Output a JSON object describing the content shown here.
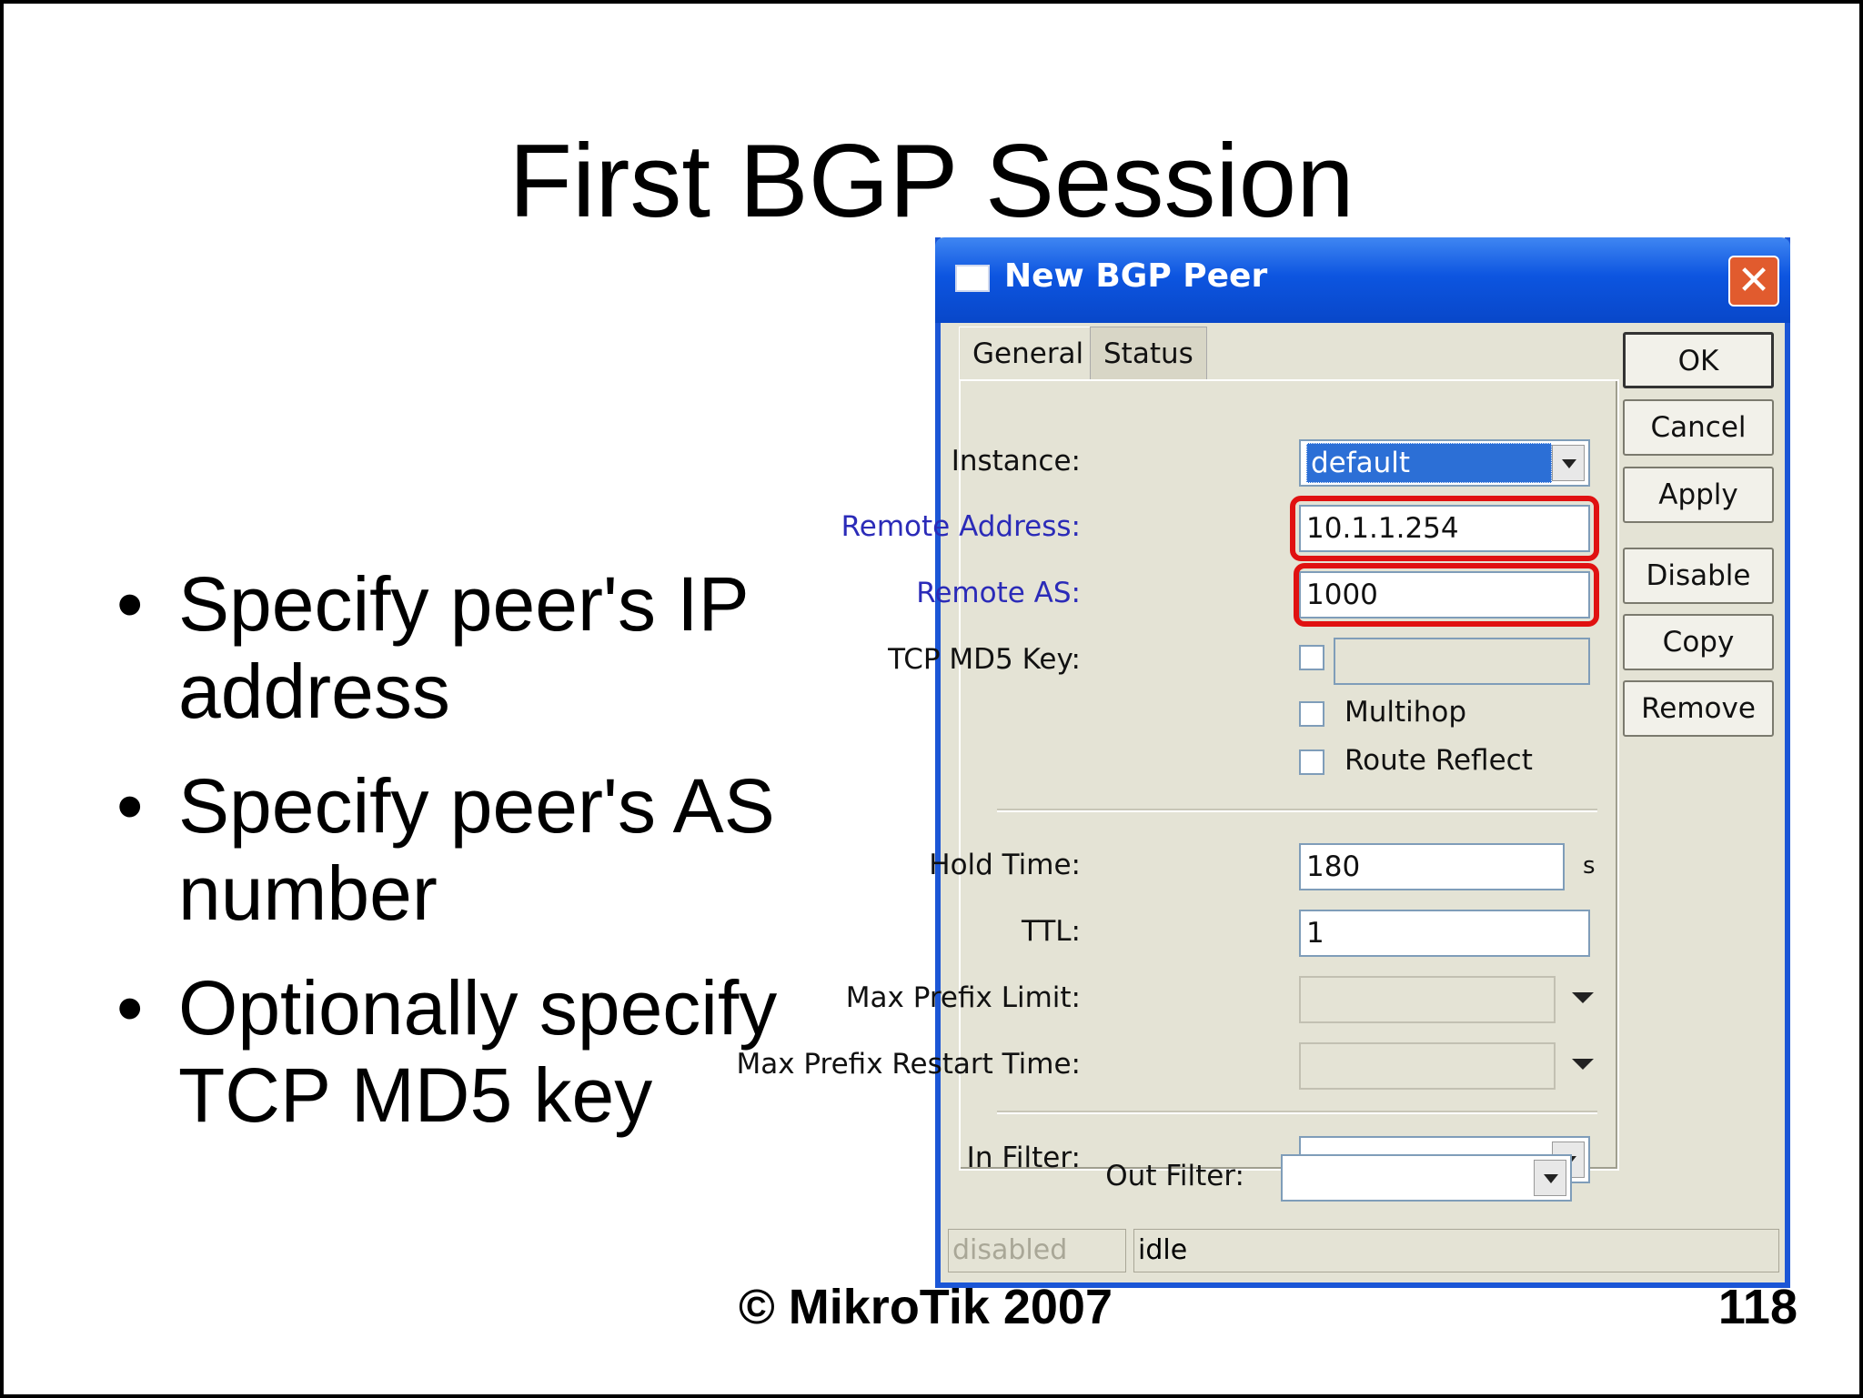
{
  "slide": {
    "title": "First BGP Session",
    "bullets": [
      "Specify peer's IP address",
      "Specify peer's AS number",
      "Optionally specify TCP MD5 key"
    ],
    "footer": "© MikroTik 2007",
    "page_number": "118"
  },
  "dialog": {
    "title": "New BGP Peer",
    "tabs": [
      {
        "label": "General",
        "active": true
      },
      {
        "label": "Status",
        "active": false
      }
    ],
    "fields": {
      "instance": {
        "label": "Instance:",
        "value": "default"
      },
      "remote_address": {
        "label": "Remote Address:",
        "value": "10.1.1.254"
      },
      "remote_as": {
        "label": "Remote AS:",
        "value": "1000"
      },
      "tcp_md5_key": {
        "label": "TCP MD5 Key:",
        "value": ""
      },
      "multihop": {
        "label": "Multihop",
        "checked": false
      },
      "route_reflect": {
        "label": "Route Reflect",
        "checked": false
      },
      "hold_time": {
        "label": "Hold Time:",
        "value": "180",
        "unit": "s"
      },
      "ttl": {
        "label": "TTL:",
        "value": "1"
      },
      "max_prefix_limit": {
        "label": "Max Prefix Limit:",
        "value": ""
      },
      "max_prefix_restart_time": {
        "label": "Max Prefix Restart Time:",
        "value": ""
      },
      "in_filter": {
        "label": "In Filter:",
        "value": ""
      },
      "out_filter": {
        "label": "Out Filter:",
        "value": ""
      }
    },
    "buttons": {
      "ok": "OK",
      "cancel": "Cancel",
      "apply": "Apply",
      "disable": "Disable",
      "copy": "Copy",
      "remove": "Remove"
    },
    "status": {
      "left": "disabled",
      "right": "idle"
    }
  },
  "colors": {
    "titlebar": "#0d55e0",
    "highlight_box": "#e01111",
    "label_blue": "#2b2bb8",
    "window_bg": "#e4e3d5"
  }
}
